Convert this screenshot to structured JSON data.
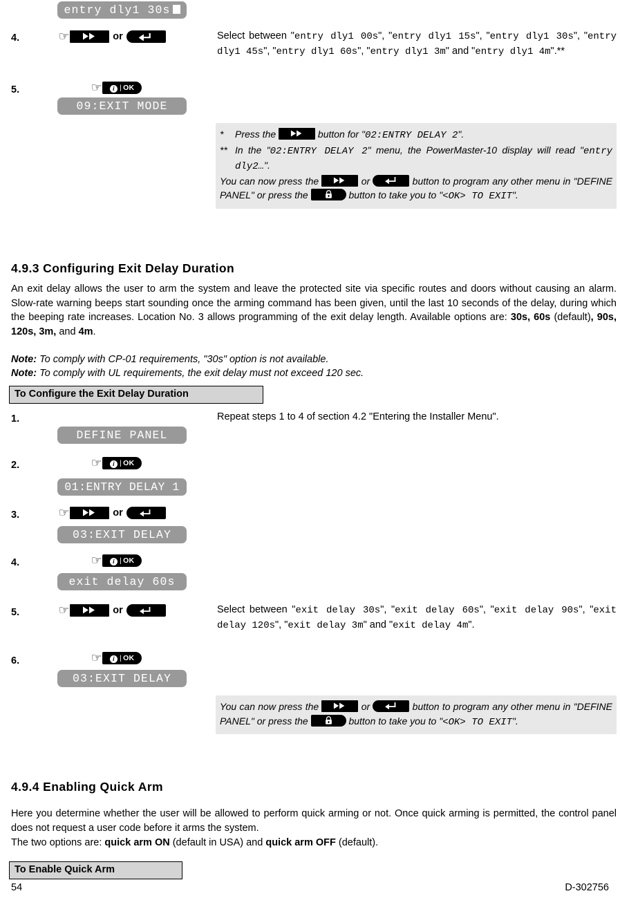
{
  "top_section": {
    "lcd_display": "entry dly1 30s",
    "steps": [
      {
        "number": "4.",
        "buttons": [
          "next-button",
          "back-button"
        ],
        "or_label": "or",
        "instruction_prefix": "Select between ",
        "options": [
          "entry dly1 00s",
          "entry dly1 15s",
          "entry dly1 30s",
          "entry dly1 45s",
          "entry dly1 60s",
          "entry dly1 3m",
          "entry dly1 4m"
        ],
        "instruction_suffix": ".**"
      },
      {
        "number": "5.",
        "buttons": [
          "ok-button"
        ],
        "lcd_display": "09:EXIT MODE"
      }
    ],
    "note": {
      "line1_mark": "*",
      "line1_before": "Press the ",
      "line1_after": " button for ",
      "line1_menu": "02:ENTRY DELAY 2",
      "line1_end": ".",
      "line2_mark": "**",
      "line2_a": "In the ",
      "line2_menu": "02:ENTRY DELAY 2",
      "line2_b": " menu, the PowerMaster-10 display will read ",
      "line2_code": "entry dly2…",
      "line2_end": ".",
      "line3_a": "You can now press the ",
      "line3_or": " or ",
      "line3_b": " button to program any other menu in ",
      "line3_menu1": "DEFINE PANEL",
      "line3_c": " or press the ",
      "line3_d": " button to take you to ",
      "line3_menu2": "<OK> TO EXIT",
      "line3_end": "."
    }
  },
  "section_493": {
    "heading": "4.9.3 Configuring Exit Delay Duration",
    "paragraph_1": "An exit delay allows the user to arm the system and leave the protected site via specific routes and doors without causing an alarm. Slow-rate warning beeps start sounding once the arming command has been given, until the last 10 seconds of the delay, during which the beeping rate increases. Location No. 3 allows programming of the exit delay length. Available options are: ",
    "options_bold_1": "30s, 60s",
    "options_mid_1": " (default)",
    "options_bold_2": ", 90s, 120s, 3m,",
    "options_mid_2": " and ",
    "options_bold_3": "4m",
    "options_end": ".",
    "note_1_label": "Note:",
    "note_1_text": " To comply with CP-01 requirements, \"30s\" option is not available.",
    "note_2_label": "Note:",
    "note_2_text": " To comply with UL requirements, the exit delay must not exceed 120 sec.",
    "caption": "To Configure the Exit Delay Duration",
    "steps": [
      {
        "number": "1.",
        "lcd_display": "DEFINE PANEL",
        "instruction": "Repeat steps 1 to 4 of section 4.2 \"Entering the Installer Menu\"."
      },
      {
        "number": "2.",
        "buttons": [
          "ok-button"
        ],
        "lcd_display": "01:ENTRY DELAY 1"
      },
      {
        "number": "3.",
        "buttons": [
          "next-button",
          "back-button"
        ],
        "or_label": "or",
        "lcd_display": "03:EXIT DELAY"
      },
      {
        "number": "4.",
        "buttons": [
          "ok-button"
        ],
        "lcd_display": "exit delay 60s"
      },
      {
        "number": "5.",
        "buttons": [
          "next-button",
          "back-button"
        ],
        "or_label": "or",
        "instruction_prefix": "Select between ",
        "options": [
          "exit delay 30s",
          "exit delay 60s",
          "exit delay 90s",
          "exit delay 120s",
          "exit delay 3m",
          "exit delay 4m"
        ],
        "instruction_suffix": "."
      },
      {
        "number": "6.",
        "buttons": [
          "ok-button"
        ],
        "lcd_display": "03:EXIT DELAY"
      }
    ],
    "note": {
      "line_a": "You can now press the ",
      "line_or": " or ",
      "line_b": " button to program any other menu in ",
      "line_menu1": "DEFINE PANEL",
      "line_c": " or press the ",
      "line_d": " button to take you to ",
      "line_menu2": "<OK> TO EXIT",
      "line_end": "."
    }
  },
  "section_494": {
    "heading": "4.9.4 Enabling Quick Arm",
    "paragraph_1": "Here you determine whether the user will be allowed to perform quick arming or not. Once quick arming is permitted, the control panel does not request a user code before it arms the system.",
    "paragraph_2_prefix": "The two options are: ",
    "option_1_bold": "quick arm ON",
    "option_1_note": " (default in USA) and ",
    "option_2_bold": "quick arm OFF",
    "option_2_note": " (default).",
    "caption": "To Enable Quick Arm"
  },
  "footer": {
    "page_number": "54",
    "document_id": "D-302756"
  },
  "colors": {
    "lcd_background": "#999999",
    "lcd_text": "#ffffff",
    "note_background": "#e8e8e8",
    "caption_background": "#d4d4d4",
    "button_background": "#000000"
  }
}
